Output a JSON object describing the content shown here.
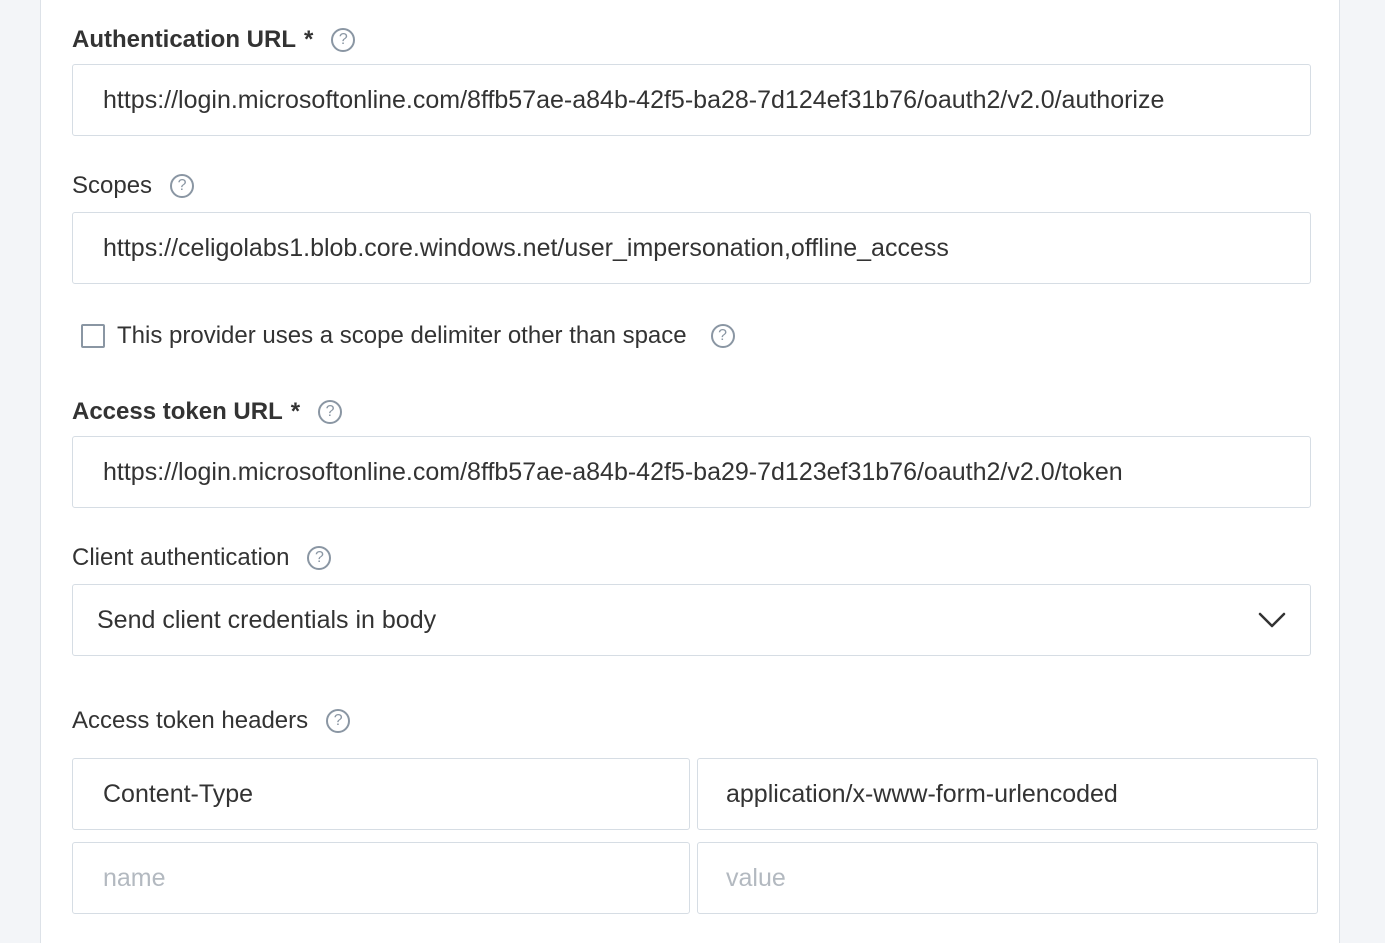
{
  "form": {
    "auth_url": {
      "label": "Authentication URL",
      "required_mark": "*",
      "help": "?",
      "value": "https://login.microsoftonline.com/8ffb57ae-a84b-42f5-ba28-7d124ef31b76/oauth2/v2.0/authorize"
    },
    "scopes": {
      "label": "Scopes",
      "help": "?",
      "value": "https://celigolabs1.blob.core.windows.net/user_impersonation,offline_access"
    },
    "scope_delimiter": {
      "label": "This provider uses a scope delimiter other than space",
      "checked": false,
      "help": "?"
    },
    "access_token_url": {
      "label": "Access token URL",
      "required_mark": "*",
      "help": "?",
      "value": "https://login.microsoftonline.com/8ffb57ae-a84b-42f5-ba29-7d123ef31b76/oauth2/v2.0/token"
    },
    "client_auth": {
      "label": "Client authentication",
      "help": "?",
      "selected": "Send client credentials in body"
    },
    "access_token_headers": {
      "label": "Access token headers",
      "help": "?",
      "rows": [
        {
          "name": "Content-Type",
          "value": "application/x-www-form-urlencoded"
        }
      ],
      "placeholder": {
        "name": "name",
        "value": "value"
      }
    }
  },
  "icons": {
    "help": "question-circle-icon",
    "dropdown": "chevron-down-icon",
    "checkbox": "checkbox-unchecked-icon"
  },
  "colors": {
    "border": "#d6dde4",
    "icon": "#8a96a3",
    "placeholder": "#b3b9c0",
    "background": "#f3f5f8"
  }
}
